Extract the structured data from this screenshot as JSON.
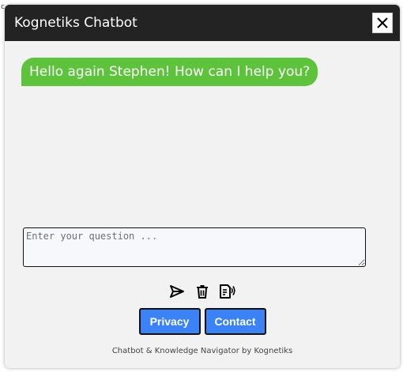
{
  "corner_text": "c",
  "window": {
    "title": "Kognetiks Chatbot",
    "close_label": "close"
  },
  "messages": [
    {
      "sender": "bot",
      "text": "Hello again Stephen! How can I help you?"
    }
  ],
  "input": {
    "placeholder": "Enter your question ...",
    "value": ""
  },
  "icons": {
    "send": "send-icon",
    "delete": "trash-icon",
    "read_aloud": "text-to-speech-icon"
  },
  "buttons": {
    "privacy": "Privacy",
    "contact": "Contact"
  },
  "footer": {
    "text": "Chatbot & Knowledge Navigator by Kognetiks"
  },
  "colors": {
    "titlebar": "#232323",
    "bot_bubble": "#5cc33a",
    "button": "#3b82f6",
    "background": "#f2f2f2"
  }
}
